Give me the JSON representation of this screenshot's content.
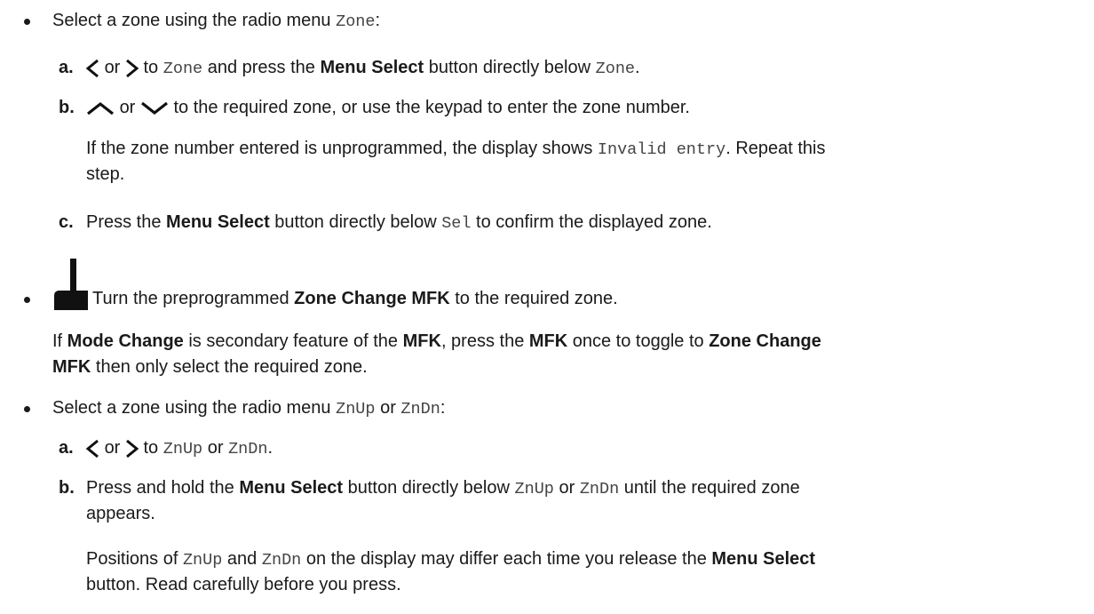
{
  "b1": {
    "t1": "Select a zone using the radio menu ",
    "m1": "Zone",
    "t2": ":",
    "steps": {
      "a": {
        "letter": "a.",
        "or": "or",
        "t1": "to ",
        "m1": "Zone",
        "t2": " and press the ",
        "bold1": "Menu Select",
        "t3": " button directly below ",
        "m2": "Zone",
        "t4": "."
      },
      "b": {
        "letter": "b.",
        "or": "or",
        "t1": "to the required zone, or use the keypad to enter the zone number.",
        "note1": "If the zone number entered is unprogrammed, the display shows ",
        "note_mono": "Invalid entry",
        "note2": ". Repeat this",
        "note3": "step."
      },
      "c": {
        "letter": "c.",
        "t1": "Press the ",
        "bold1": "Menu Select",
        "t2": " button directly below ",
        "m1": "Sel",
        "t3": " to confirm the displayed zone."
      }
    }
  },
  "b2": {
    "icon": "knob-icon",
    "t1": "Turn the preprogrammed ",
    "bold1": "Zone Change MFK",
    "t2": " to the required zone.",
    "note": {
      "t1": "If ",
      "bold1": "Mode Change",
      "t2": " is secondary feature of the ",
      "bold2": "MFK",
      "t3": ", press the ",
      "bold3": "MFK",
      "t4": " once to toggle to ",
      "bold4": "Zone Change",
      "bold5": "MFK",
      "t5": " then only select the required zone."
    }
  },
  "b3": {
    "t1": "Select a zone using the radio menu ",
    "m1": "ZnUp",
    "or": " or ",
    "m2": "ZnDn",
    "t2": ":",
    "steps": {
      "a": {
        "letter": "a.",
        "or": "or",
        "t1": "to ",
        "m1": "ZnUp",
        "or2": " or ",
        "m2": "ZnDn",
        "t2": "."
      },
      "b": {
        "letter": "b.",
        "t1": "Press and hold the ",
        "bold1": "Menu Select",
        "t2": " button directly below ",
        "m1": "ZnUp",
        "or": " or ",
        "m2": "ZnDn",
        "t3": " until the required zone",
        "t4": "appears.",
        "note1": "Positions of ",
        "nm1": "ZnUp",
        "note2": " and ",
        "nm2": "ZnDn",
        "note3": " on the display may differ each time you release the ",
        "nbold": "Menu Select",
        "note4": "button. Read carefully before you press."
      }
    }
  }
}
